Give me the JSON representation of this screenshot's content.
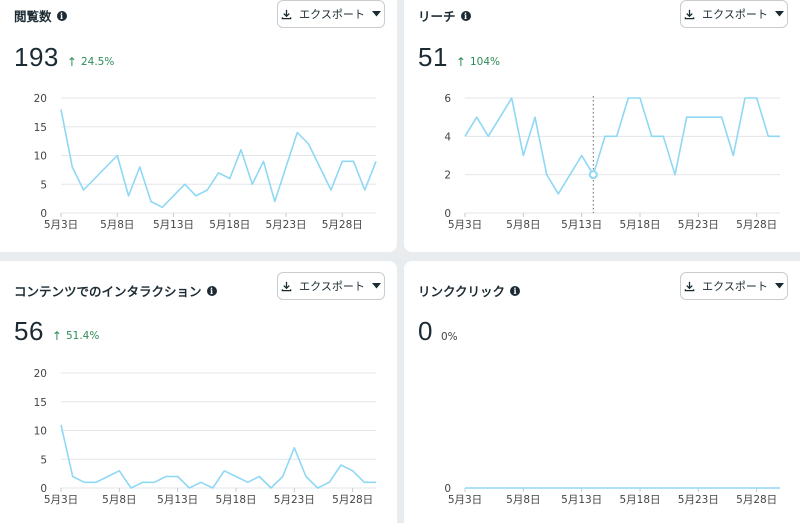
{
  "export_label": "エクスポート",
  "info_icon_glyph": "i",
  "line_color": "#8fd8f5",
  "grid_color": "#e3e6e9",
  "positive_color": "#2e8b57",
  "cards": [
    {
      "title": "閲覧数",
      "value": "193",
      "change": "24.5%",
      "change_direction": "up",
      "chart_data": {
        "type": "line",
        "x": [
          "5月3日",
          "5月4日",
          "5月5日",
          "5月6日",
          "5月7日",
          "5月8日",
          "5月9日",
          "5月10日",
          "5月11日",
          "5月12日",
          "5月13日",
          "5月14日",
          "5月15日",
          "5月16日",
          "5月17日",
          "5月18日",
          "5月19日",
          "5月20日",
          "5月21日",
          "5月22日",
          "5月23日",
          "5月24日",
          "5月25日",
          "5月26日",
          "5月27日",
          "5月28日",
          "5月29日",
          "5月30日"
        ],
        "x_tick_labels": [
          "5月3日",
          "5月8日",
          "5月13日",
          "5月18日",
          "5月23日",
          "5月28日"
        ],
        "y_ticks": [
          0,
          5,
          10,
          15,
          20
        ],
        "ylim": [
          0,
          20
        ],
        "series": [
          {
            "values": [
              18,
              8,
              4,
              6,
              8,
              10,
              3,
              8,
              2,
              1,
              3,
              5,
              3,
              4,
              7,
              6,
              11,
              5,
              9,
              2,
              8,
              14,
              12,
              8,
              4,
              9,
              9,
              4,
              9
            ]
          }
        ]
      }
    },
    {
      "title": "リーチ",
      "value": "51",
      "change": "104%",
      "change_direction": "up",
      "chart_data": {
        "type": "line",
        "x": [
          "5月3日",
          "5月4日",
          "5月5日",
          "5月6日",
          "5月7日",
          "5月8日",
          "5月9日",
          "5月10日",
          "5月11日",
          "5月12日",
          "5月13日",
          "5月14日",
          "5月15日",
          "5月16日",
          "5月17日",
          "5月18日",
          "5月19日",
          "5月20日",
          "5月21日",
          "5月22日",
          "5月23日",
          "5月24日",
          "5月25日",
          "5月26日",
          "5月27日",
          "5月28日",
          "5月29日",
          "5月30日"
        ],
        "x_tick_labels": [
          "5月3日",
          "5月8日",
          "5月13日",
          "5月18日",
          "5月23日",
          "5月28日"
        ],
        "y_ticks": [
          0,
          2,
          4,
          6
        ],
        "ylim": [
          0,
          6
        ],
        "hover_index": 11,
        "series": [
          {
            "values": [
              4,
              5,
              4,
              5,
              6,
              3,
              5,
              2,
              1,
              2,
              3,
              2,
              4,
              4,
              6,
              6,
              4,
              4,
              2,
              5,
              5,
              5,
              5,
              3,
              6,
              6,
              4,
              4
            ]
          }
        ]
      }
    },
    {
      "title": "コンテンツでのインタラクション",
      "value": "56",
      "change": "51.4%",
      "change_direction": "up",
      "chart_data": {
        "type": "line",
        "x": [
          "5月3日",
          "5月4日",
          "5月5日",
          "5月6日",
          "5月7日",
          "5月8日",
          "5月9日",
          "5月10日",
          "5月11日",
          "5月12日",
          "5月13日",
          "5月14日",
          "5月15日",
          "5月16日",
          "5月17日",
          "5月18日",
          "5月19日",
          "5月20日",
          "5月21日",
          "5月22日",
          "5月23日",
          "5月24日",
          "5月25日",
          "5月26日",
          "5月27日",
          "5月28日",
          "5月29日",
          "5月30日"
        ],
        "x_tick_labels": [
          "5月3日",
          "5月8日",
          "5月13日",
          "5月18日",
          "5月23日",
          "5月28日"
        ],
        "y_ticks": [
          0,
          5,
          10,
          15,
          20
        ],
        "ylim": [
          0,
          20
        ],
        "series": [
          {
            "values": [
              11,
              2,
              1,
              1,
              2,
              3,
              0,
              1,
              1,
              2,
              2,
              0,
              1,
              0,
              3,
              2,
              1,
              2,
              0,
              2,
              7,
              2,
              0,
              1,
              4,
              3,
              1,
              1
            ]
          }
        ]
      }
    },
    {
      "title": "リンククリック",
      "value": "0",
      "change": "0%",
      "change_direction": "none",
      "chart_data": {
        "type": "line",
        "x": [
          "5月3日",
          "5月4日",
          "5月5日",
          "5月6日",
          "5月7日",
          "5月8日",
          "5月9日",
          "5月10日",
          "5月11日",
          "5月12日",
          "5月13日",
          "5月14日",
          "5月15日",
          "5月16日",
          "5月17日",
          "5月18日",
          "5月19日",
          "5月20日",
          "5月21日",
          "5月22日",
          "5月23日",
          "5月24日",
          "5月25日",
          "5月26日",
          "5月27日",
          "5月28日",
          "5月29日",
          "5月30日"
        ],
        "x_tick_labels": [
          "5月3日",
          "5月8日",
          "5月13日",
          "5月18日",
          "5月23日",
          "5月28日"
        ],
        "y_ticks": [
          0
        ],
        "ylim": [
          0,
          1
        ],
        "series": [
          {
            "values": [
              0,
              0,
              0,
              0,
              0,
              0,
              0,
              0,
              0,
              0,
              0,
              0,
              0,
              0,
              0,
              0,
              0,
              0,
              0,
              0,
              0,
              0,
              0,
              0,
              0,
              0,
              0,
              0
            ]
          }
        ]
      }
    }
  ]
}
